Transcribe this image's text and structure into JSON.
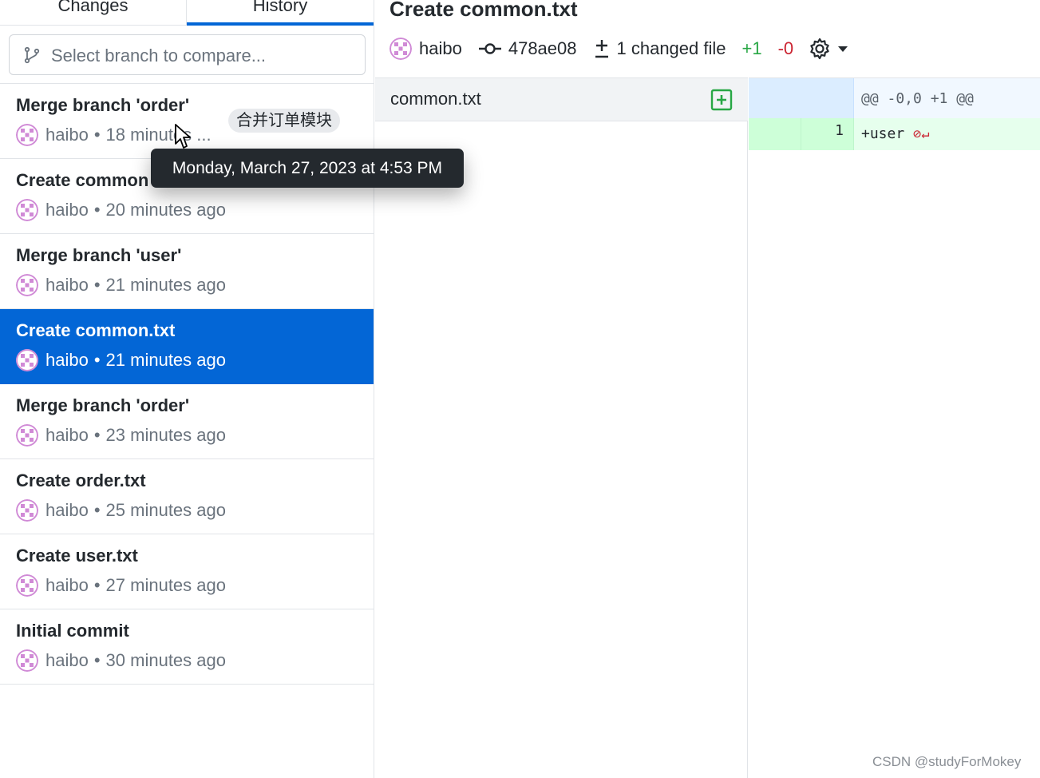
{
  "tabs": {
    "changes": "Changes",
    "history": "History"
  },
  "branch_compare": {
    "placeholder": "Select branch to compare..."
  },
  "commits": [
    {
      "title": "Merge branch 'order'",
      "author": "haibo",
      "time": "18 minutes ...",
      "tag": "合并订单模块"
    },
    {
      "title": "Create common",
      "author": "haibo",
      "time": "20 minutes ago"
    },
    {
      "title": "Merge branch 'user'",
      "author": "haibo",
      "time": "21 minutes ago"
    },
    {
      "title": "Create common.txt",
      "author": "haibo",
      "time": "21 minutes ago",
      "selected": true
    },
    {
      "title": "Merge branch 'order'",
      "author": "haibo",
      "time": "23 minutes ago"
    },
    {
      "title": "Create order.txt",
      "author": "haibo",
      "time": "25 minutes ago"
    },
    {
      "title": "Create user.txt",
      "author": "haibo",
      "time": "27 minutes ago"
    },
    {
      "title": "Initial commit",
      "author": "haibo",
      "time": "30 minutes ago"
    }
  ],
  "separator": "•",
  "tooltip": "Monday, March 27, 2023 at 4:53 PM",
  "commit_detail": {
    "title": "Create common.txt",
    "author": "haibo",
    "sha": "478ae08",
    "changed_files": "1 changed file",
    "additions": "+1",
    "deletions": "-0"
  },
  "files": [
    {
      "name": "common.txt",
      "status": "added"
    }
  ],
  "diff": {
    "hunk_header": "@@ -0,0 +1 @@",
    "lines": [
      {
        "new_line_number": "1",
        "content": "+user"
      }
    ]
  },
  "colors": {
    "accent": "#0366d6",
    "addition": "#28a745",
    "deletion": "#cb2431",
    "avatar": "#d08ad6"
  },
  "watermark": "CSDN @studyForMokey"
}
